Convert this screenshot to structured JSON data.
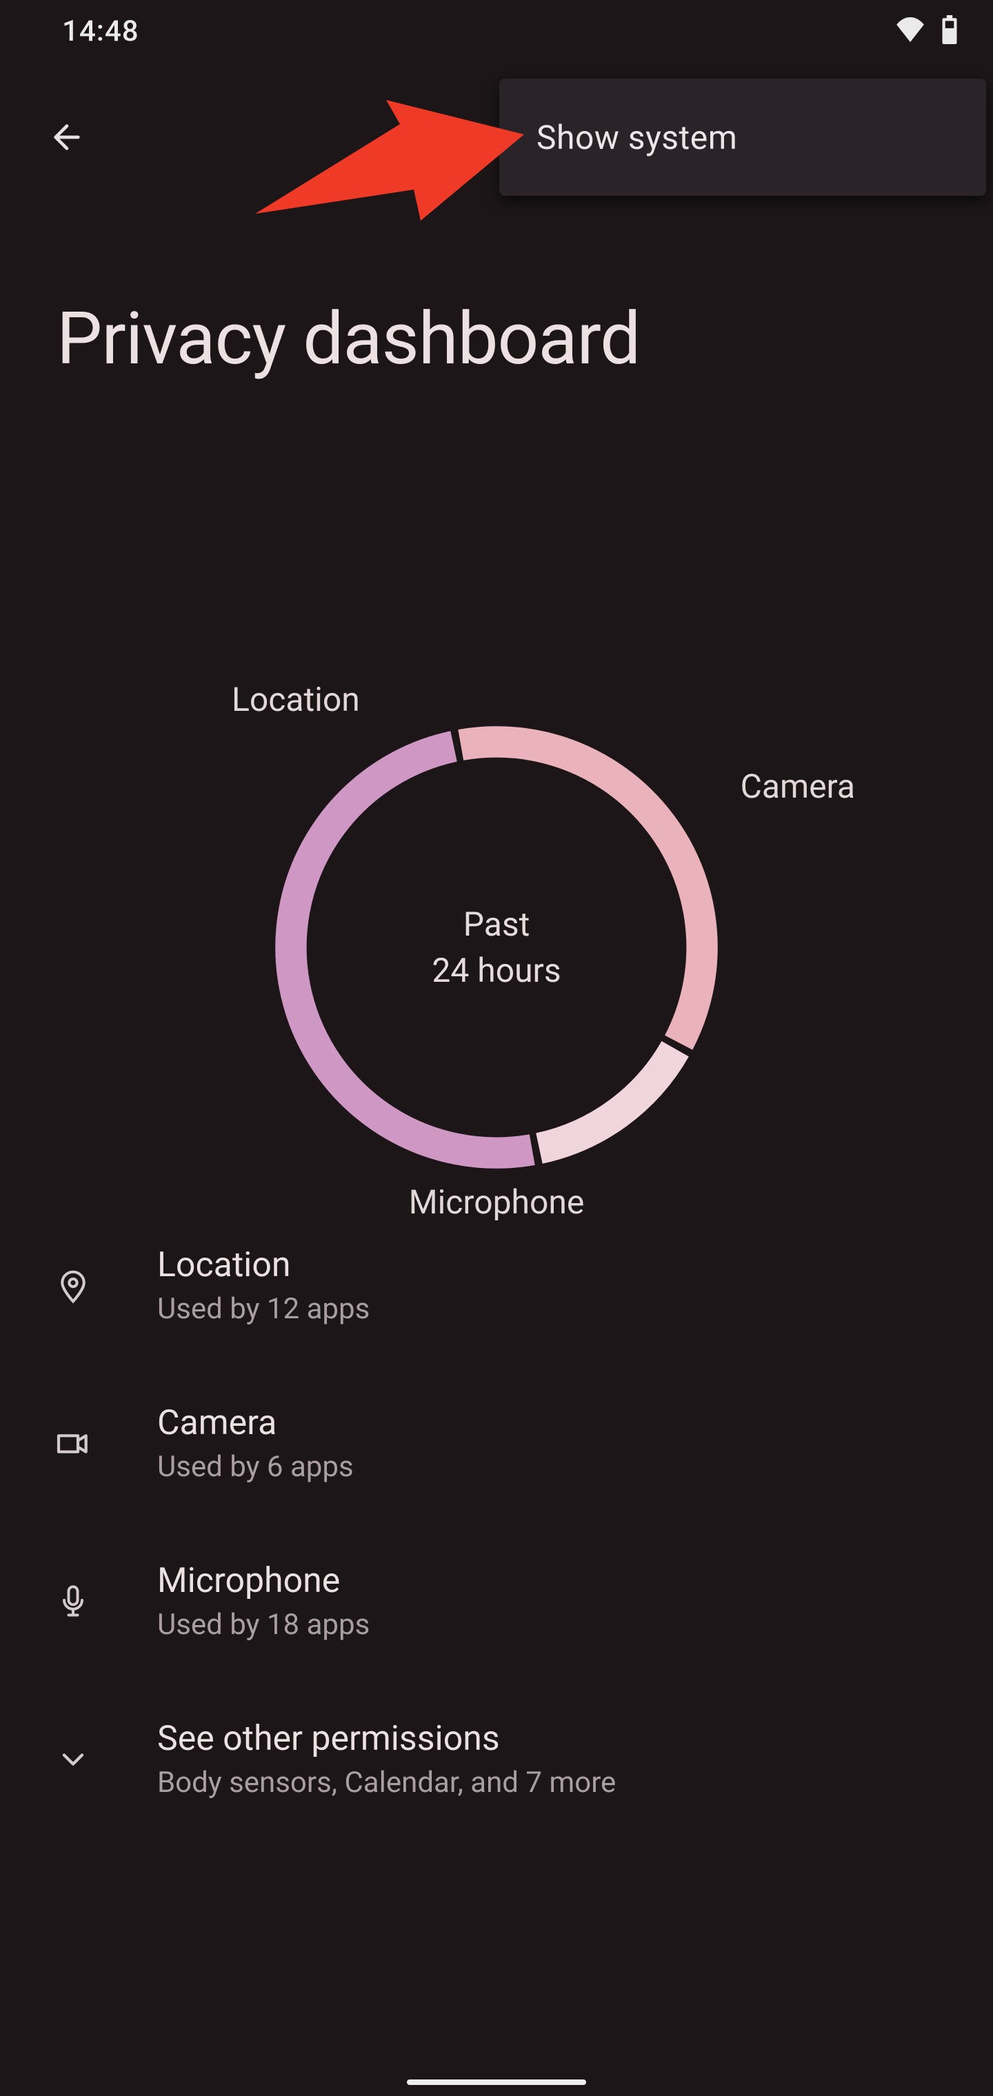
{
  "status": {
    "time": "14:48"
  },
  "menu": {
    "show_system": "Show system"
  },
  "page": {
    "title": "Privacy dashboard"
  },
  "chart_data": {
    "type": "pie",
    "title": "Past 24 hours",
    "categories": [
      "Location",
      "Camera",
      "Microphone"
    ],
    "values": [
      36,
      14,
      50
    ],
    "colors": [
      "#eab3bb",
      "#f0d5dc",
      "#cf98c4"
    ]
  },
  "chart_labels": {
    "center_line1": "Past",
    "center_line2": "24 hours",
    "location": "Location",
    "camera": "Camera",
    "microphone": "Microphone"
  },
  "list": {
    "location": {
      "title": "Location",
      "sub": "Used by 12 apps"
    },
    "camera": {
      "title": "Camera",
      "sub": "Used by 6 apps"
    },
    "microphone": {
      "title": "Microphone",
      "sub": "Used by 18 apps"
    },
    "other": {
      "title": "See other permissions",
      "sub": "Body sensors, Calendar, and 7 more"
    }
  }
}
